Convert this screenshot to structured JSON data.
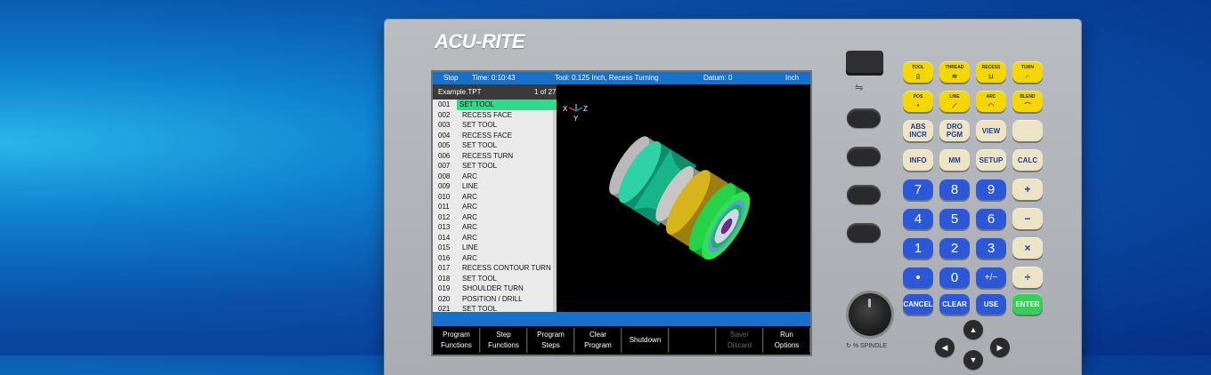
{
  "brand": "ACU-RITE",
  "status": {
    "mode": "Stop",
    "time": "Time: 0:10:43",
    "tool": "Tool: 0.125 Inch, Recess Turning",
    "datum": "Datum: 0",
    "units": "Inch"
  },
  "program": {
    "filename": "Example.TPT",
    "position": "1 of 27",
    "rows": [
      {
        "num": "001",
        "text": "SET TOOL"
      },
      {
        "num": "002",
        "text": "RECESS FACE"
      },
      {
        "num": "003",
        "text": "SET TOOL"
      },
      {
        "num": "004",
        "text": "RECESS FACE"
      },
      {
        "num": "005",
        "text": "SET TOOL"
      },
      {
        "num": "006",
        "text": "RECESS TURN"
      },
      {
        "num": "007",
        "text": "SET TOOL"
      },
      {
        "num": "008",
        "text": "ARC"
      },
      {
        "num": "009",
        "text": "LINE"
      },
      {
        "num": "010",
        "text": "ARC"
      },
      {
        "num": "011",
        "text": "ARC"
      },
      {
        "num": "012",
        "text": "ARC"
      },
      {
        "num": "013",
        "text": "ARC"
      },
      {
        "num": "014",
        "text": "ARC"
      },
      {
        "num": "015",
        "text": "LINE"
      },
      {
        "num": "016",
        "text": "ARC"
      },
      {
        "num": "017",
        "text": "RECESS CONTOUR TURN"
      },
      {
        "num": "018",
        "text": "SET TOOL"
      },
      {
        "num": "019",
        "text": "SHOULDER TURN"
      },
      {
        "num": "020",
        "text": "POSITION / DRILL"
      },
      {
        "num": "021",
        "text": "SET TOOL"
      }
    ]
  },
  "axes": {
    "x": "X",
    "y": "Y",
    "z": "Z"
  },
  "softkeys": [
    {
      "label": "Program\nFunctions"
    },
    {
      "label": "Step\nFunctions"
    },
    {
      "label": "Program\nSteps"
    },
    {
      "label": "Clear\nProgram"
    },
    {
      "label": "Shutdown"
    },
    {
      "label": ""
    },
    {
      "label": "Save/\nDiscard"
    },
    {
      "label": "Run\nOptions"
    }
  ],
  "keys": {
    "tool": "TOOL",
    "thread": "THREAD",
    "recess": "RECESS",
    "turn": "TURN",
    "pos": "POS",
    "line": "LINE",
    "arc": "ARC",
    "blend": "BLEND",
    "abs": "ABS INCR",
    "dro": "DRO PGM",
    "view": "VIEW",
    "info": "INFO",
    "mm": "MM",
    "setup": "SETUP",
    "calc": "CALC",
    "d7": "7",
    "d8": "8",
    "d9": "9",
    "plus": "+",
    "d4": "4",
    "d5": "5",
    "d6": "6",
    "minus": "−",
    "d1": "1",
    "d2": "2",
    "d3": "3",
    "times": "×",
    "dot": "•",
    "d0": "0",
    "pm": "+/−",
    "div": "÷",
    "cancel": "CANCEL",
    "clear": "CLEAR",
    "use": "USE",
    "enter": "ENTER"
  },
  "spindle_label": "% SPINDLE",
  "colors": {
    "status_bar": "#1671cc",
    "selected_row": "#33d98a",
    "yellow_key": "#f5d700",
    "blue_key": "#2c58d8"
  }
}
